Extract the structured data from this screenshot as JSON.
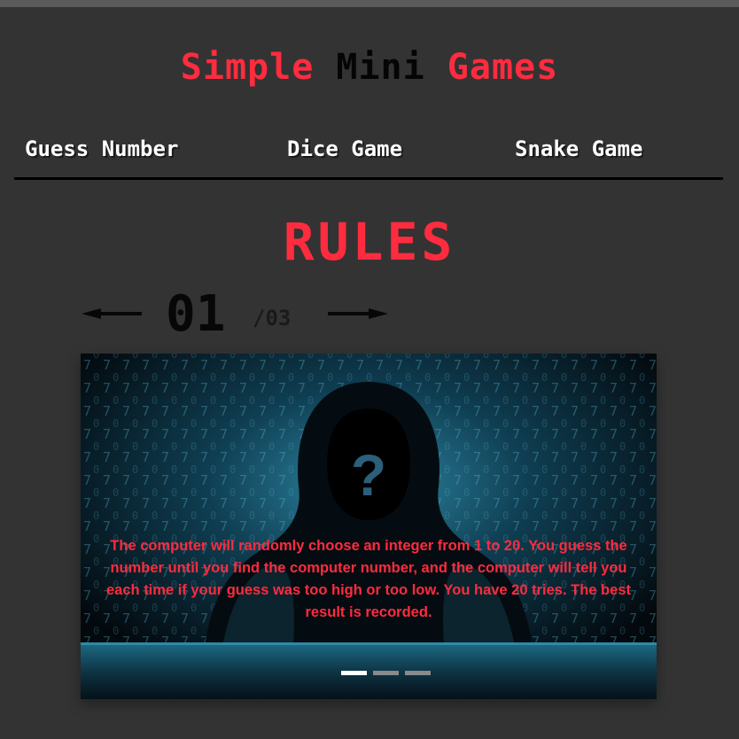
{
  "header": {
    "title_parts": [
      "Simple",
      "Mini",
      "Games"
    ]
  },
  "nav": {
    "items": [
      {
        "label": "Guess Number"
      },
      {
        "label": "Dice Game"
      },
      {
        "label": "Snake Game"
      }
    ]
  },
  "rules": {
    "heading": "RULES",
    "counter": {
      "current": "01",
      "total": "/03",
      "prev_icon": "left-arrow-icon",
      "next_icon": "right-arrow-icon"
    },
    "slide": {
      "image_subject": "hooded-hacker",
      "face_glyph": "?",
      "text": "The computer will randomly choose an integer from 1 to 20. You guess the number until you find the computer number, and the computer will tell you each time if your guess was too high or too low. You have 20 tries. The best result is recorded.",
      "active_index": 0,
      "slide_count": 3
    }
  },
  "colors": {
    "background": "#333333",
    "accent": "#ff2b3f",
    "title_dark": "#050505",
    "nav_text": "#ffffff"
  }
}
